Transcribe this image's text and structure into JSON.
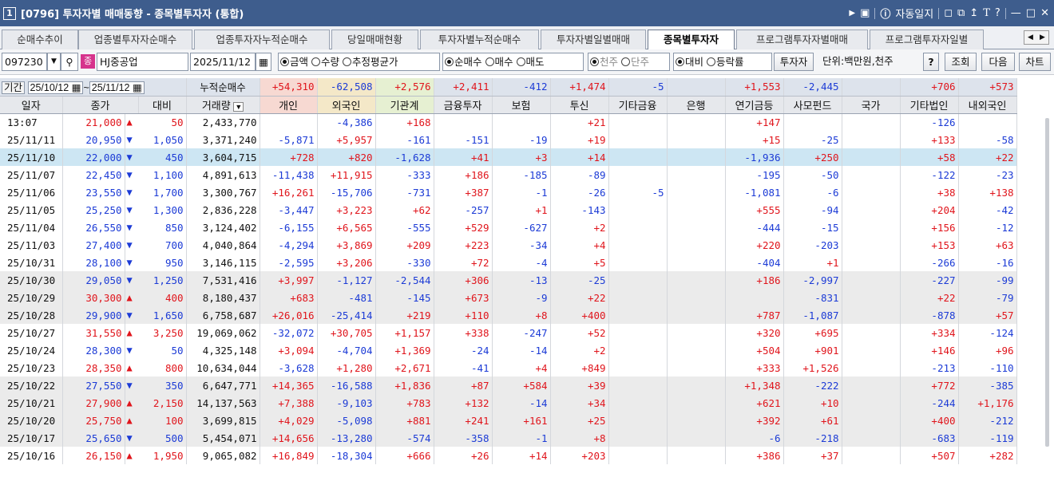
{
  "title": {
    "num": "1",
    "text": "[0796] 투자자별 매매동향 - 종목별투자자 (통합)",
    "right_label": "자동일지"
  },
  "tabs": [
    "순매수추이",
    "업종별투자자순매수",
    "업종투자자누적순매수",
    "당일매매현황",
    "투자자별누적순매수",
    "투자자별일별매매",
    "종목별투자자",
    "프로그램투자자별매매",
    "프로그램투자자일별"
  ],
  "active_tab": 6,
  "toolbar": {
    "code": "097230",
    "badge": "종",
    "name": "HJ중공업",
    "date": "2025/11/12",
    "r1": [
      "금액",
      "수량",
      "추정평균가"
    ],
    "r2": [
      "순매수",
      "매수",
      "매도"
    ],
    "r3": [
      "천주",
      "단주"
    ],
    "r4": [
      "대비",
      "등락률"
    ],
    "investor_btn": "투자자",
    "unit": "단위:백만원,천주",
    "help": "?",
    "query": "조회",
    "next": "다음",
    "chart": "차트"
  },
  "period": {
    "label": "기간",
    "from": "25/10/12",
    "to": "25/11/12",
    "cum_label": "누적순매수"
  },
  "summary": [
    "+54,310",
    "-62,508",
    "+2,576",
    "+2,411",
    "-412",
    "+1,474",
    "-5",
    "",
    "+1,553",
    "-2,445",
    "",
    "+706",
    "+573"
  ],
  "headers": [
    "일자",
    "종가",
    "대비",
    "거래량",
    "개인",
    "외국인",
    "기관계",
    "금융투자",
    "보험",
    "투신",
    "기타금융",
    "은행",
    "연기금등",
    "사모펀드",
    "국가",
    "기타법인",
    "내외국인"
  ],
  "rows": [
    [
      "13:07",
      "21,000",
      "up",
      "50",
      "2,433,770",
      "",
      "-4,386",
      "+168",
      "",
      "",
      "+21",
      "",
      "",
      "+147",
      "",
      "",
      "-126",
      ""
    ],
    [
      "25/11/11",
      "20,950",
      "dn",
      "1,050",
      "3,371,240",
      "-5,871",
      "+5,957",
      "-161",
      "-151",
      "-19",
      "+19",
      "",
      "",
      "+15",
      "-25",
      "",
      "+133",
      "-58"
    ],
    [
      "25/11/10",
      "22,000",
      "dn",
      "450",
      "3,604,715",
      "+728",
      "+820",
      "-1,628",
      "+41",
      "+3",
      "+14",
      "",
      "",
      "-1,936",
      "+250",
      "",
      "+58",
      "+22"
    ],
    [
      "25/11/07",
      "22,450",
      "dn",
      "1,100",
      "4,891,613",
      "-11,438",
      "+11,915",
      "-333",
      "+186",
      "-185",
      "-89",
      "",
      "",
      "-195",
      "-50",
      "",
      "-122",
      "-23"
    ],
    [
      "25/11/06",
      "23,550",
      "dn",
      "1,700",
      "3,300,767",
      "+16,261",
      "-15,706",
      "-731",
      "+387",
      "-1",
      "-26",
      "-5",
      "",
      "-1,081",
      "-6",
      "",
      "+38",
      "+138"
    ],
    [
      "25/11/05",
      "25,250",
      "dn",
      "1,300",
      "2,836,228",
      "-3,447",
      "+3,223",
      "+62",
      "-257",
      "+1",
      "-143",
      "",
      "",
      "+555",
      "-94",
      "",
      "+204",
      "-42"
    ],
    [
      "25/11/04",
      "26,550",
      "dn",
      "850",
      "3,124,402",
      "-6,155",
      "+6,565",
      "-555",
      "+529",
      "-627",
      "+2",
      "",
      "",
      "-444",
      "-15",
      "",
      "+156",
      "-12"
    ],
    [
      "25/11/03",
      "27,400",
      "dn",
      "700",
      "4,040,864",
      "-4,294",
      "+3,869",
      "+209",
      "+223",
      "-34",
      "+4",
      "",
      "",
      "+220",
      "-203",
      "",
      "+153",
      "+63"
    ],
    [
      "25/10/31",
      "28,100",
      "dn",
      "950",
      "3,146,115",
      "-2,595",
      "+3,206",
      "-330",
      "+72",
      "-4",
      "+5",
      "",
      "",
      "-404",
      "+1",
      "",
      "-266",
      "-16"
    ],
    [
      "25/10/30",
      "29,050",
      "dn",
      "1,250",
      "7,531,416",
      "+3,997",
      "-1,127",
      "-2,544",
      "+306",
      "-13",
      "-25",
      "",
      "",
      "+186",
      "-2,997",
      "",
      "-227",
      "-99"
    ],
    [
      "25/10/29",
      "30,300",
      "up",
      "400",
      "8,180,437",
      "+683",
      "-481",
      "-145",
      "+673",
      "-9",
      "+22",
      "",
      "",
      "",
      "-831",
      "",
      "+22",
      "-79"
    ],
    [
      "25/10/28",
      "29,900",
      "dn",
      "1,650",
      "6,758,687",
      "+26,016",
      "-25,414",
      "+219",
      "+110",
      "+8",
      "+400",
      "",
      "",
      "+787",
      "-1,087",
      "",
      "-878",
      "+57"
    ],
    [
      "25/10/27",
      "31,550",
      "up",
      "3,250",
      "19,069,062",
      "-32,072",
      "+30,705",
      "+1,157",
      "+338",
      "-247",
      "+52",
      "",
      "",
      "+320",
      "+695",
      "",
      "+334",
      "-124"
    ],
    [
      "25/10/24",
      "28,300",
      "dn",
      "50",
      "4,325,148",
      "+3,094",
      "-4,704",
      "+1,369",
      "-24",
      "-14",
      "+2",
      "",
      "",
      "+504",
      "+901",
      "",
      "+146",
      "+96"
    ],
    [
      "25/10/23",
      "28,350",
      "up",
      "800",
      "10,634,044",
      "-3,628",
      "+1,280",
      "+2,671",
      "-41",
      "+4",
      "+849",
      "",
      "",
      "+333",
      "+1,526",
      "",
      "-213",
      "-110"
    ],
    [
      "25/10/22",
      "27,550",
      "dn",
      "350",
      "6,647,771",
      "+14,365",
      "-16,588",
      "+1,836",
      "+87",
      "+584",
      "+39",
      "",
      "",
      "+1,348",
      "-222",
      "",
      "+772",
      "-385"
    ],
    [
      "25/10/21",
      "27,900",
      "up",
      "2,150",
      "14,137,563",
      "+7,388",
      "-9,103",
      "+783",
      "+132",
      "-14",
      "+34",
      "",
      "",
      "+621",
      "+10",
      "",
      "-244",
      "+1,176"
    ],
    [
      "25/10/20",
      "25,750",
      "up",
      "100",
      "3,699,815",
      "+4,029",
      "-5,098",
      "+881",
      "+241",
      "+161",
      "+25",
      "",
      "",
      "+392",
      "+61",
      "",
      "+400",
      "-212"
    ],
    [
      "25/10/17",
      "25,650",
      "dn",
      "500",
      "5,454,071",
      "+14,656",
      "-13,280",
      "-574",
      "-358",
      "-1",
      "+8",
      "",
      "",
      "-6",
      "-218",
      "",
      "-683",
      "-119"
    ],
    [
      "25/10/16",
      "26,150",
      "up",
      "1,950",
      "9,065,082",
      "+16,849",
      "-18,304",
      "+666",
      "+26",
      "+14",
      "+203",
      "",
      "",
      "+386",
      "+37",
      "",
      "+507",
      "+282"
    ]
  ],
  "shaded_rows": [
    2,
    9,
    10,
    11,
    15,
    16,
    17,
    18
  ],
  "selected_row": 2,
  "colors": {
    "title_bg": "#3e5d8d",
    "up": "#e0151c",
    "down": "#1c3bd6",
    "selected": "#cde6f3"
  }
}
